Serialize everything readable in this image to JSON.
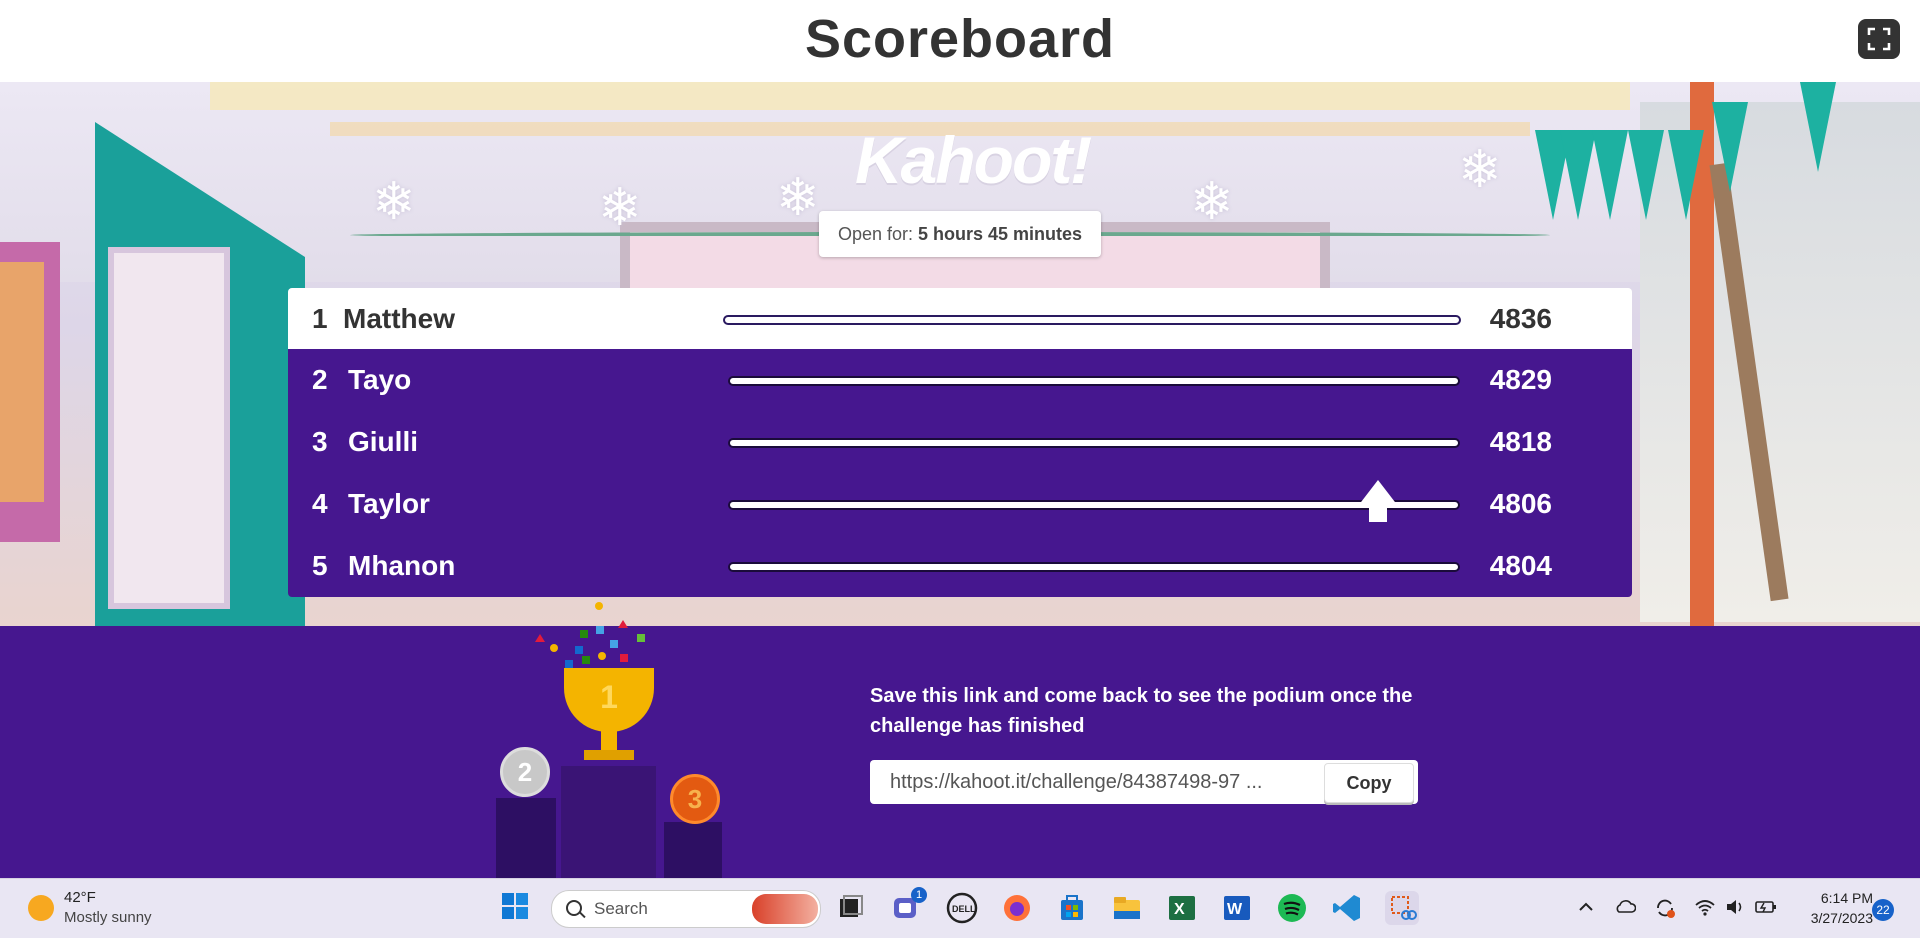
{
  "header": {
    "title": "Scoreboard"
  },
  "logo": {
    "text": "Kahoot!"
  },
  "open_for": {
    "label": "Open for:",
    "value": "5 hours 45 minutes"
  },
  "leaderboard": [
    {
      "rank": "1",
      "name": "Matthew",
      "score": "4836"
    },
    {
      "rank": "2",
      "name": "Tayo",
      "score": "4829"
    },
    {
      "rank": "3",
      "name": "Giulli",
      "score": "4818"
    },
    {
      "rank": "4",
      "name": "Taylor",
      "score": "4806"
    },
    {
      "rank": "5",
      "name": "Mhanon",
      "score": "4804"
    }
  ],
  "podium": {
    "first": "1",
    "second": "2",
    "third": "3"
  },
  "save_message": "Save this link and come back to see the podium once the challenge has finished",
  "share": {
    "link": "https://kahoot.it/challenge/84387498-97 ...",
    "copy_label": "Copy"
  },
  "taskbar": {
    "temperature": "42°F",
    "condition": "Mostly sunny",
    "search_placeholder": "Search",
    "teams_badge": "1",
    "time": "6:14 PM",
    "date": "3/27/2023",
    "notifications": "22"
  },
  "colors": {
    "kahoot_purple": "#46178f",
    "accent_gold": "#f4b400"
  }
}
